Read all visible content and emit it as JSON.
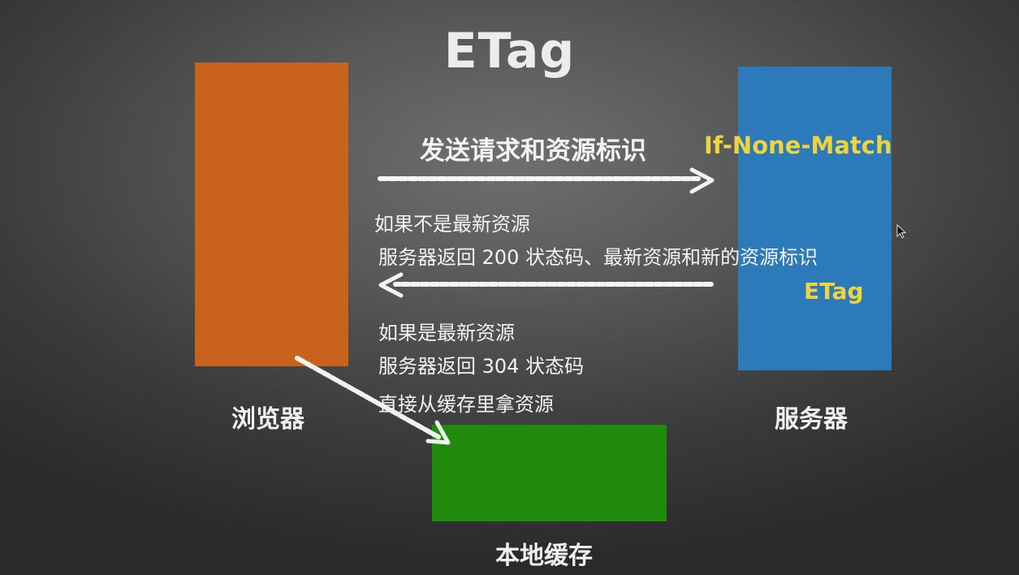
{
  "title": "ETag",
  "nodes": {
    "browser": {
      "label": "浏览器",
      "color": "#c8621c"
    },
    "server": {
      "label": "服务器",
      "color": "#2c7ab9"
    },
    "cache": {
      "label": "本地缓存",
      "color": "#1f8a0c"
    }
  },
  "request": {
    "label": "发送请求和资源标识",
    "header": "If-None-Match"
  },
  "response_modified": {
    "line1": "如果不是最新资源",
    "line2": "服务器返回 200 状态码、最新资源和新的资源标识",
    "header": "ETag"
  },
  "response_not_modified": {
    "line1": "如果是最新资源",
    "line2": "服务器返回 304 状态码",
    "line3": "直接从缓存里拿资源"
  },
  "colors": {
    "highlight": "#f1d33c",
    "text": "#f2f2f2",
    "arrow": "#ffffff"
  }
}
